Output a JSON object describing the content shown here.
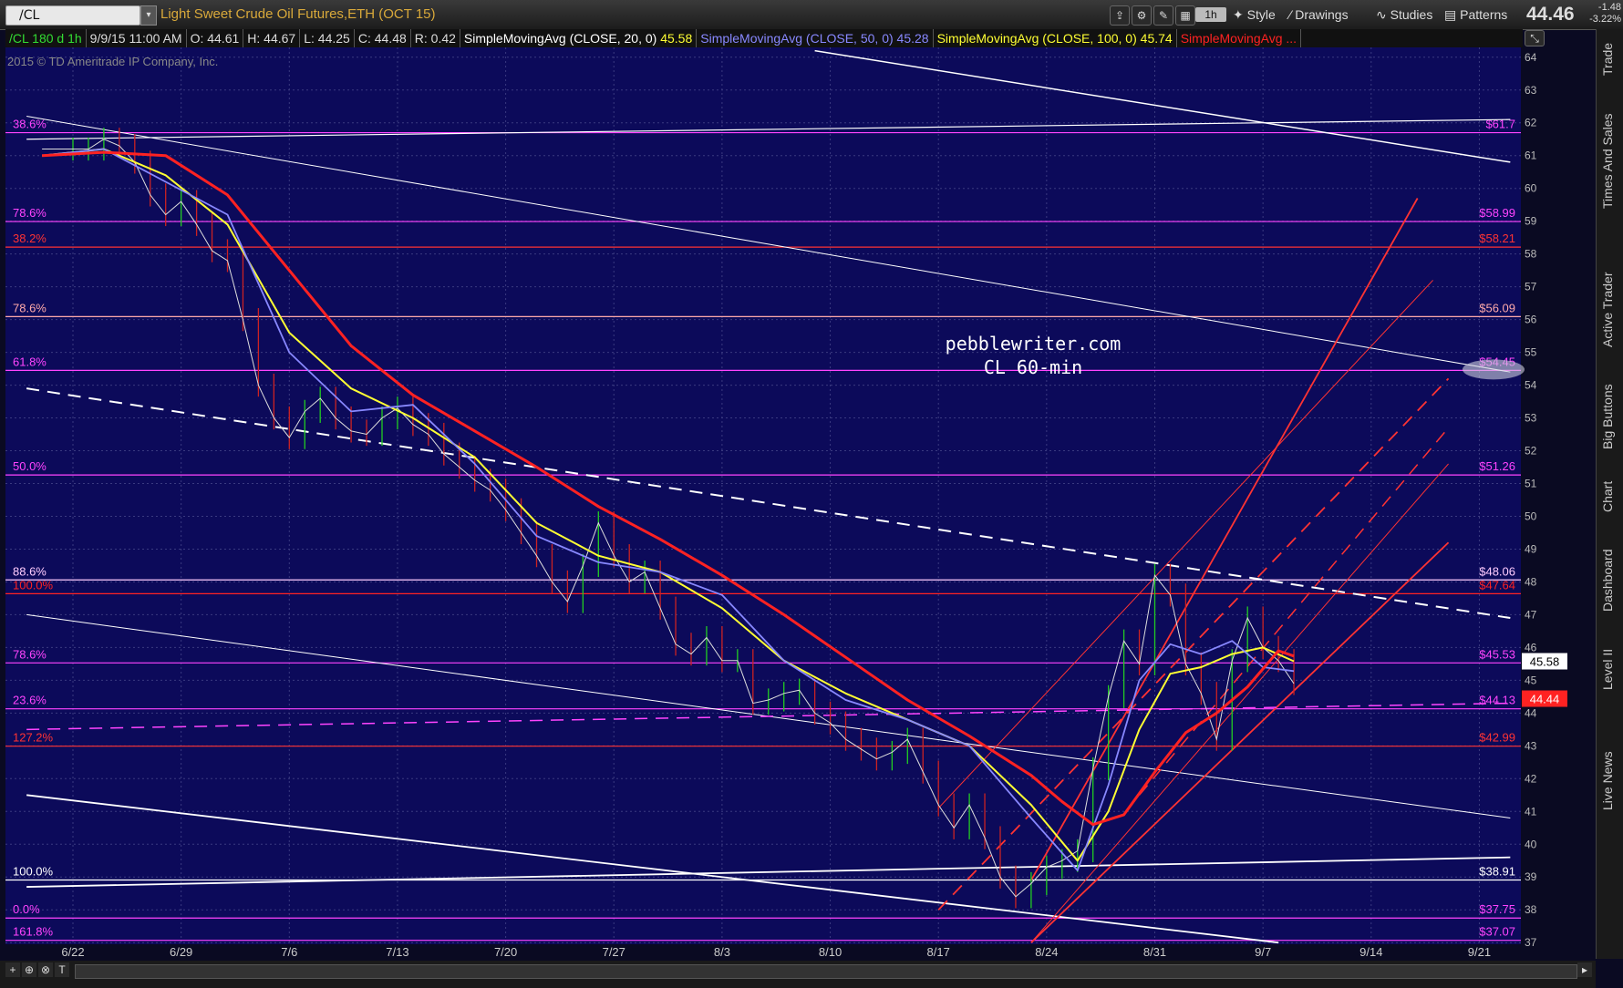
{
  "toolbar": {
    "symbol": "/CL",
    "instrument_name": "Light Sweet Crude Oil Futures,ETH (OCT 15)",
    "timeframe": "1h",
    "style_label": "Style",
    "drawings_label": "Drawings",
    "studies_label": "Studies",
    "patterns_label": "Patterns",
    "last_price": "44.46",
    "net_change": "-1.48",
    "pct_change": "-3.22%"
  },
  "study_header": {
    "symbol_period": "/CL 180 d 1h",
    "date": "9/9/15 11:00 AM",
    "open": "O: 44.61",
    "high": "H: 44.67",
    "low": "L: 44.25",
    "close": "C: 44.48",
    "range": "R: 0.42",
    "sma20": "SimpleMovingAvg (CLOSE, 20, 0)",
    "sma20_val": "45.58",
    "sma50": "SimpleMovingAvg (CLOSE, 50, 0)",
    "sma50_val": "45.28",
    "sma100": "SimpleMovingAvg (CLOSE, 100, 0)",
    "sma100_val": "45.74",
    "sma_extra": "SimpleMovingAvg ...",
    "colors": {
      "sma20": "#ffff33",
      "sma50": "#8888ff",
      "sma100": "#ff2222"
    }
  },
  "copyright": "2015 © TD Ameritrade IP Company, Inc.",
  "watermark": {
    "line1": "pebblewriter.com",
    "line2": "CL 60-min"
  },
  "side_tabs": [
    "Trade",
    "Times And Sales",
    "Active Trader",
    "Big Buttons",
    "Chart",
    "Dashboard",
    "Level II",
    "Live News"
  ],
  "chart_data": {
    "type": "line",
    "title": "Light Sweet Crude Oil Futures,ETH (OCT 15)",
    "ylim": [
      37,
      64
    ],
    "y_ticks": [
      37,
      38,
      39,
      40,
      41,
      42,
      43,
      44,
      45,
      46,
      47,
      48,
      49,
      50,
      51,
      52,
      53,
      54,
      55,
      56,
      57,
      58,
      59,
      60,
      61,
      62,
      63,
      64
    ],
    "x_ticks": [
      "6/22",
      "6/29",
      "7/6",
      "7/13",
      "7/20",
      "7/27",
      "8/3",
      "8/10",
      "8/17",
      "8/24",
      "8/31",
      "9/7",
      "9/14",
      "9/21"
    ],
    "x_tick_days": [
      0,
      7,
      14,
      21,
      28,
      35,
      42,
      49,
      56,
      63,
      70,
      77,
      84,
      91
    ],
    "price": {
      "days": [
        -2,
        0,
        1,
        2,
        3,
        4,
        5,
        6,
        7,
        8,
        9,
        10,
        11,
        12,
        13,
        14,
        15,
        16,
        17,
        18,
        19,
        20,
        21,
        22,
        23,
        24,
        25,
        26,
        27,
        28,
        29,
        30,
        31,
        32,
        33,
        34,
        35,
        36,
        37,
        38,
        39,
        40,
        41,
        42,
        43,
        44,
        45,
        46,
        47,
        48,
        49,
        50,
        51,
        52,
        53,
        54,
        55,
        56,
        57,
        58,
        59,
        60,
        61,
        62,
        63,
        64,
        65,
        66,
        67,
        68,
        69,
        70,
        71,
        72,
        73,
        74,
        75,
        76,
        77,
        78,
        79
      ],
      "values": [
        61.2,
        61.2,
        61.2,
        61.5,
        61.3,
        60.8,
        59.8,
        59.2,
        59.6,
        58.9,
        58.1,
        57.8,
        56.0,
        54.0,
        53.0,
        52.4,
        53.2,
        53.6,
        53.0,
        52.6,
        52.5,
        53.0,
        53.3,
        52.8,
        52.5,
        51.9,
        51.5,
        51.1,
        50.8,
        50.2,
        49.5,
        48.8,
        48.0,
        47.4,
        48.5,
        49.8,
        48.8,
        48.0,
        48.3,
        47.2,
        46.1,
        45.8,
        46.3,
        45.6,
        45.6,
        44.3,
        44.4,
        44.6,
        44.7,
        44.0,
        43.7,
        43.2,
        42.9,
        42.6,
        42.8,
        43.2,
        42.2,
        41.2,
        40.5,
        41.2,
        40.2,
        39.0,
        38.4,
        38.8,
        39.3,
        39.5,
        39.8,
        42.3,
        44.5,
        46.2,
        45.5,
        48.2,
        47.6,
        45.5,
        44.6,
        43.2,
        45.6,
        46.9,
        46.0,
        45.6,
        44.9,
        44.6,
        44.48
      ]
    },
    "series": [
      {
        "name": "SimpleMovingAvg (CLOSE, 20, 0)",
        "color": "#ffff33",
        "days": [
          -2,
          2,
          6,
          10,
          14,
          18,
          22,
          26,
          30,
          34,
          38,
          42,
          46,
          50,
          54,
          58,
          62,
          65,
          67,
          69,
          71,
          73,
          75,
          77,
          79
        ],
        "values": [
          61.0,
          61.2,
          60.4,
          58.9,
          55.6,
          53.9,
          53.0,
          51.8,
          49.8,
          48.8,
          48.3,
          47.2,
          45.6,
          44.6,
          43.8,
          43.0,
          41.2,
          39.5,
          41.0,
          43.5,
          45.2,
          45.4,
          45.8,
          46.0,
          45.58
        ]
      },
      {
        "name": "SimpleMovingAvg (CLOSE, 50, 0)",
        "color": "#8888ff",
        "days": [
          -2,
          2,
          6,
          10,
          14,
          18,
          22,
          26,
          30,
          34,
          38,
          42,
          46,
          50,
          54,
          58,
          62,
          65,
          67,
          69,
          71,
          73,
          75,
          77,
          79
        ],
        "values": [
          61.0,
          61.2,
          60.2,
          59.2,
          55.0,
          53.2,
          53.4,
          51.6,
          49.4,
          48.6,
          48.3,
          47.6,
          45.6,
          44.4,
          43.8,
          43.0,
          40.8,
          39.2,
          41.8,
          45.0,
          46.1,
          45.8,
          46.2,
          45.4,
          45.28
        ]
      },
      {
        "name": "SimpleMovingAvg (CLOSE, 100, 0)",
        "color": "#ff2222",
        "days": [
          -2,
          2,
          6,
          10,
          14,
          18,
          22,
          26,
          30,
          34,
          38,
          42,
          46,
          50,
          54,
          58,
          62,
          64,
          66,
          68,
          70,
          72,
          74,
          76,
          78,
          79
        ],
        "values": [
          61.0,
          61.1,
          61.0,
          59.8,
          57.5,
          55.2,
          53.7,
          52.6,
          51.5,
          50.3,
          49.3,
          48.2,
          47.0,
          45.7,
          44.4,
          43.3,
          42.1,
          41.3,
          40.6,
          40.9,
          42.2,
          43.4,
          44.0,
          44.8,
          45.9,
          45.74
        ]
      }
    ],
    "horizontal_levels": [
      {
        "price": 61.7,
        "left_label": "38.6%",
        "right_label": "$61.7",
        "color": "#ff44ff"
      },
      {
        "price": 58.99,
        "left_label": "78.6%",
        "right_label": "$58.99",
        "color": "#ff44ff"
      },
      {
        "price": 58.21,
        "left_label": "38.2%",
        "right_label": "$58.21",
        "color": "#ff3333"
      },
      {
        "price": 56.09,
        "left_label": "78.6%",
        "right_label": "$56.09",
        "color": "#ffaaaa"
      },
      {
        "price": 54.45,
        "left_label": "61.8%",
        "right_label": "$54.45",
        "color": "#ff44ff"
      },
      {
        "price": 51.26,
        "left_label": "50.0%",
        "right_label": "$51.26",
        "color": "#ff44ff"
      },
      {
        "price": 48.06,
        "left_label": "88.6%",
        "right_label": "$48.06",
        "color": "#ffccff"
      },
      {
        "price": 47.64,
        "left_label": "100.0%",
        "right_label": "$47.64",
        "color": "#ff2222"
      },
      {
        "price": 45.53,
        "left_label": "78.6%",
        "right_label": "$45.53",
        "color": "#ff44ff"
      },
      {
        "price": 44.13,
        "left_label": "23.6%",
        "right_label": "$44.13",
        "color": "#ff44ff"
      },
      {
        "price": 42.99,
        "left_label": "127.2%",
        "right_label": "$42.99",
        "color": "#ff3333"
      },
      {
        "price": 38.91,
        "left_label": "100.0%",
        "right_label": "$38.91",
        "color": "#ffffff"
      },
      {
        "price": 37.75,
        "left_label": "0.0%",
        "right_label": "$37.75",
        "color": "#ff44ff"
      },
      {
        "price": 37.07,
        "left_label": "161.8%",
        "right_label": "$37.07",
        "color": "#ff44ff"
      }
    ],
    "trendlines": [
      {
        "color": "#ffffff",
        "dash": false,
        "width": 1.5,
        "from": [
          48,
          64.2
        ],
        "to": [
          93,
          60.8
        ]
      },
      {
        "color": "#ffffff",
        "dash": false,
        "width": 1.2,
        "from": [
          -3,
          61.5
        ],
        "to": [
          93,
          62.1
        ]
      },
      {
        "color": "#ffffff",
        "dash": false,
        "width": 1,
        "from": [
          -3,
          62.2
        ],
        "to": [
          93,
          54.4
        ]
      },
      {
        "color": "#ffffff",
        "dash": true,
        "width": 2,
        "from": [
          -3,
          53.9
        ],
        "to": [
          93,
          46.9
        ]
      },
      {
        "color": "#ffffff",
        "dash": false,
        "width": 1,
        "from": [
          -3,
          47.0
        ],
        "to": [
          93,
          40.8
        ]
      },
      {
        "color": "#ffffff",
        "dash": false,
        "width": 1.8,
        "from": [
          -3,
          41.5
        ],
        "to": [
          78,
          37.0
        ]
      },
      {
        "color": "#ffffff",
        "dash": false,
        "width": 1.8,
        "from": [
          -3,
          38.7
        ],
        "to": [
          93,
          39.6
        ]
      },
      {
        "color": "#ff3333",
        "dash": false,
        "width": 1.8,
        "from": [
          62,
          38.9
        ],
        "to": [
          87,
          59.7
        ]
      },
      {
        "color": "#ff3333",
        "dash": false,
        "width": 1,
        "from": [
          56,
          41.1
        ],
        "to": [
          88,
          57.2
        ]
      },
      {
        "color": "#ff3333",
        "dash": true,
        "width": 1.8,
        "from": [
          56,
          38.0
        ],
        "to": [
          89,
          54.2
        ]
      },
      {
        "color": "#ff3333",
        "dash": true,
        "width": 1.5,
        "from": [
          69,
          41.5
        ],
        "to": [
          89,
          52.7
        ]
      },
      {
        "color": "#ff3333",
        "dash": false,
        "width": 1,
        "from": [
          62,
          37.0
        ],
        "to": [
          89,
          51.6
        ]
      },
      {
        "color": "#ff3333",
        "dash": false,
        "width": 1.8,
        "from": [
          62,
          37.0
        ],
        "to": [
          89,
          49.2
        ]
      },
      {
        "color": "#ff44ff",
        "dash": true,
        "width": 1.5,
        "from": [
          -3,
          43.5
        ],
        "to": [
          93,
          44.3
        ]
      }
    ],
    "price_badges": [
      {
        "price": 45.58,
        "label": "45.58",
        "bg": "#ffffff",
        "fg": "#000000"
      },
      {
        "price": 44.44,
        "label": "44.44",
        "bg": "#ff2222",
        "fg": "#ffffff"
      }
    ]
  }
}
